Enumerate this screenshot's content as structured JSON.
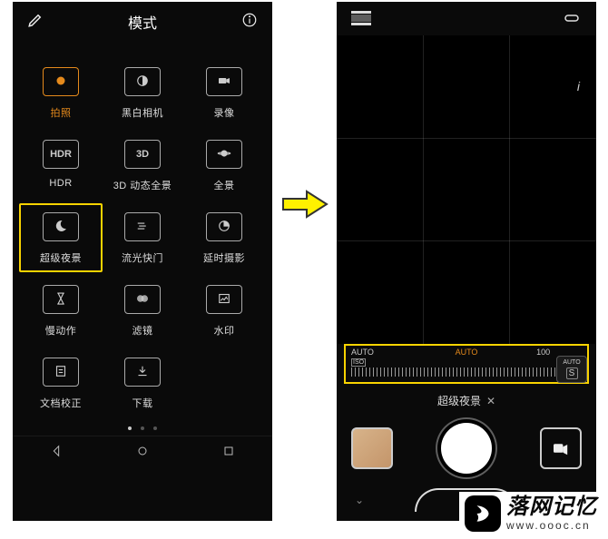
{
  "left": {
    "title": "模式",
    "modes": [
      {
        "id": "photo",
        "label": "拍照",
        "selected": true,
        "highlighted": false
      },
      {
        "id": "bw",
        "label": "黑白相机",
        "selected": false,
        "highlighted": false
      },
      {
        "id": "video",
        "label": "录像",
        "selected": false,
        "highlighted": false
      },
      {
        "id": "hdr",
        "label": "HDR",
        "selected": false,
        "highlighted": false,
        "text": "HDR"
      },
      {
        "id": "3dpano",
        "label": "3D 动态全景",
        "selected": false,
        "highlighted": false,
        "text": "3D"
      },
      {
        "id": "pano",
        "label": "全景",
        "selected": false,
        "highlighted": false
      },
      {
        "id": "night",
        "label": "超级夜景",
        "selected": false,
        "highlighted": true
      },
      {
        "id": "light",
        "label": "流光快门",
        "selected": false,
        "highlighted": false
      },
      {
        "id": "timelapse",
        "label": "延时摄影",
        "selected": false,
        "highlighted": false
      },
      {
        "id": "slowmo",
        "label": "慢动作",
        "selected": false,
        "highlighted": false
      },
      {
        "id": "filter",
        "label": "滤镜",
        "selected": false,
        "highlighted": false
      },
      {
        "id": "watermark",
        "label": "水印",
        "selected": false,
        "highlighted": false
      },
      {
        "id": "docscan",
        "label": "文档校正",
        "selected": false,
        "highlighted": false
      },
      {
        "id": "download",
        "label": "下载",
        "selected": false,
        "highlighted": false
      }
    ],
    "page_dots": {
      "count": 3,
      "active": 0
    }
  },
  "right": {
    "scale": {
      "left_label": "AUTO",
      "left_sub": "ISO",
      "center_label": "AUTO",
      "right_label": "100"
    },
    "mode_label": "超级夜景",
    "auto_s": {
      "top": "AUTO",
      "bottom": "S"
    }
  },
  "watermark": {
    "logo_text": "S",
    "title": "落网记忆",
    "url": "www.oooc.cn"
  }
}
